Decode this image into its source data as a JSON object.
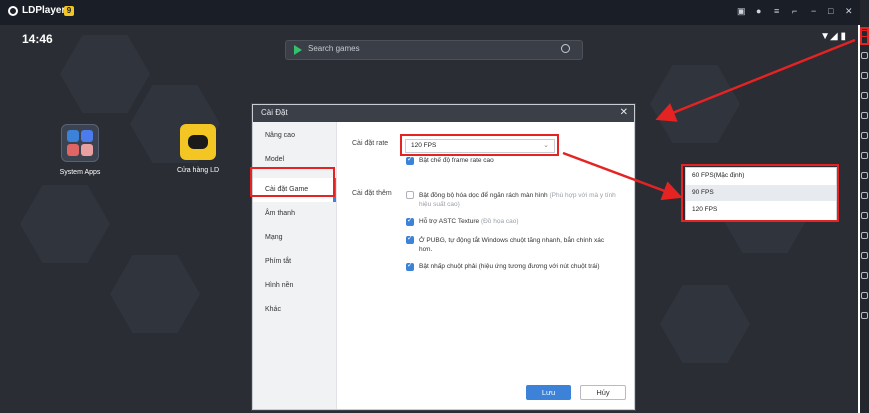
{
  "titlebar": {
    "app_name": "LDPlayer",
    "badge": "9"
  },
  "status": {
    "time": "14:46"
  },
  "search": {
    "placeholder": "Search games"
  },
  "desktop_apps": [
    {
      "label": "System Apps"
    },
    {
      "label": "Cửa hàng LD"
    }
  ],
  "dialog": {
    "title": "Cài Đặt",
    "nav": [
      "Nâng cao",
      "Model",
      "Cài đặt Game",
      "Âm thanh",
      "Mạng",
      "Phím tắt",
      "Hình nền",
      "Khác"
    ],
    "active_nav_index": 2,
    "frame_rate_label": "Cài đặt rate",
    "frame_rate_value": "120 FPS",
    "high_frame_rate": "Bật chế độ frame rate cao",
    "other_label": "Cài đặt thêm",
    "options": [
      {
        "text": "Bật đồng bộ hóa dọc để ngăn rách màn hình",
        "note": "(Phù hợp với mà y tính hiệu suất cao)",
        "checked": false
      },
      {
        "text": "Hỗ trợ ASTC Texture",
        "note": "(Đồ họa cao)",
        "checked": true
      },
      {
        "text": "Ở PUBG, tự động tắt Windows chuột tăng nhanh, bắn chính xác hơn.",
        "note": "",
        "checked": true
      },
      {
        "text": "Bật nhấp chuột phải (hiệu ứng tương đương với nút chuột trái)",
        "note": "",
        "checked": true
      }
    ],
    "save": "Lưu",
    "cancel": "Hủy"
  },
  "fps_dropdown": {
    "options": [
      "60 FPS(Mặc định)",
      "90 FPS",
      "120 FPS"
    ],
    "highlighted_index": 1
  },
  "colors": {
    "accent": "#3b82d8",
    "annotation": "#e52323",
    "titlebar": "#1a1e27"
  }
}
